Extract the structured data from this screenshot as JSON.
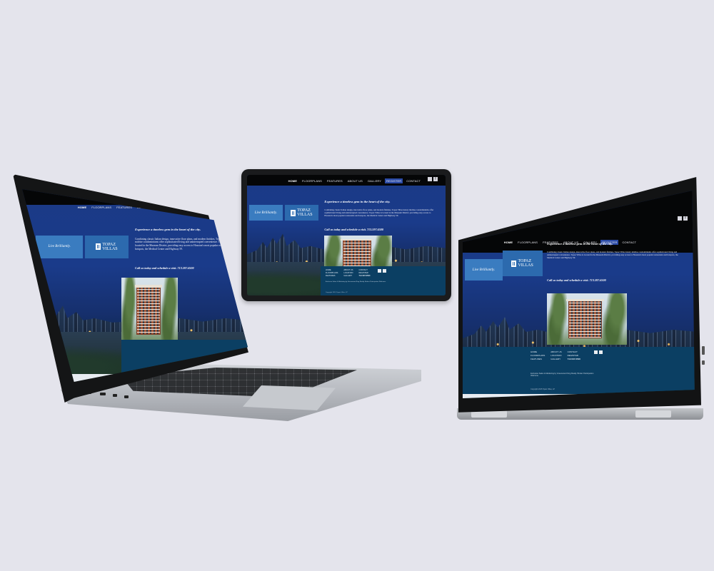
{
  "site": {
    "nav": [
      "HOME",
      "FLOORPLANS",
      "FEATURES",
      "ABOUT US",
      "GALLERY",
      "REGISTER",
      "CONTACT"
    ],
    "tagline": "Live Brilliantly.",
    "logo_top": "TOPAZ",
    "logo_bottom": "VILLAS",
    "headline": "Experience a timeless gem in the heart of the city.",
    "body": "Combining classic Italian design, innovative floor plans, and modern finishes, Topaz Villas luxury midrise condominiums offer sophisticated living and uninterrupted convenience. Topaz Villas is located in the Museum District, providing easy access to Houston's most popular restaurants and hotspots, the Medical Center and Highway 59.",
    "callout": "Call us today and schedule a visit. 713.597.6500",
    "footer_links": [
      "HOME",
      "ABOUT US",
      "CONTACT",
      "FLOORPLANS",
      "LOCATION",
      "REGISTER",
      "FEATURES",
      "GALLERY",
      "713.597.6500"
    ],
    "footer_text": "Exclusive Sales & Marketing by Greenwood King Realty. Broker Participation Welcome.",
    "copyright": "Copyright 2015 Topaz Villas, LP"
  }
}
